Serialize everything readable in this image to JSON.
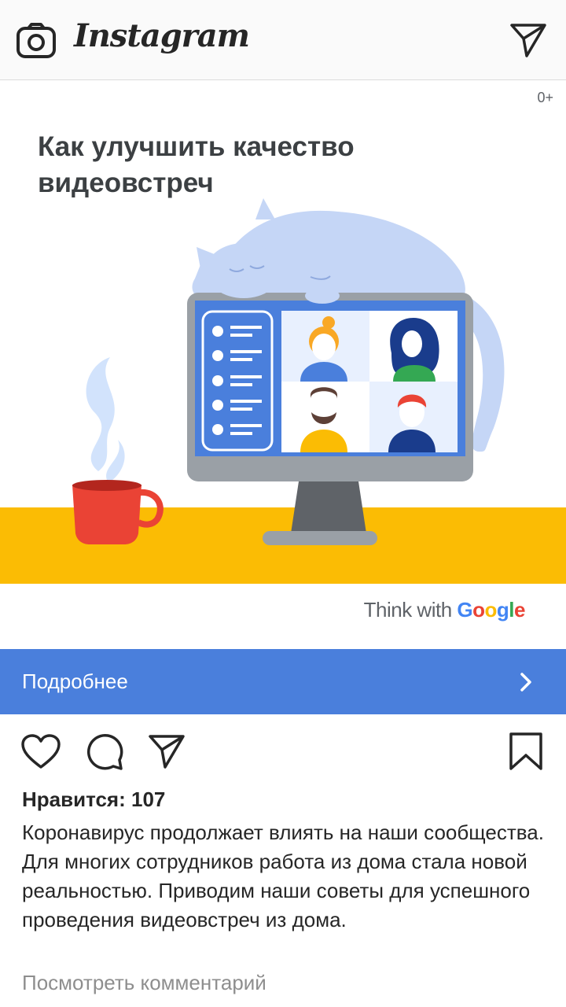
{
  "header": {
    "brand": "Instagram",
    "camera_icon": "camera-icon",
    "direct_icon": "paper-plane-icon"
  },
  "ad": {
    "age_rating": "0+",
    "headline": "Как улучшить качество видеовстреч",
    "logo_prefix": "Think with",
    "logo_brand": "Google",
    "google_colors": [
      "#4285F4",
      "#EA4335",
      "#FBBC05",
      "#4285F4",
      "#34A853",
      "#EA4335"
    ]
  },
  "cta": {
    "label": "Подробнее",
    "icon": "chevron-right-icon",
    "color": "#4a7fdc"
  },
  "actions": {
    "like_icon": "heart-icon",
    "comment_icon": "comment-icon",
    "share_icon": "paper-plane-icon",
    "save_icon": "bookmark-icon"
  },
  "post": {
    "likes": "Нравится: 107",
    "caption": "Коронавирус продолжает влиять на наши сообщества. Для многих сотрудников работа из дома стала новой реальностью. Приводим наши советы для успешного проведения видеовстреч из дома.",
    "view_comments": "Посмотреть комментарий"
  }
}
